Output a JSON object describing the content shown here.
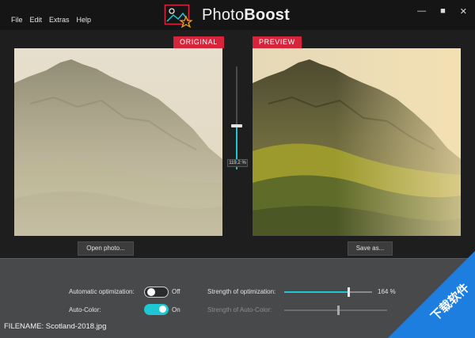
{
  "menu": [
    "File",
    "Edit",
    "Extras",
    "Help"
  ],
  "app": {
    "title_a": "Photo",
    "title_b": "Boost"
  },
  "window": {
    "minimize": "—",
    "maximize": "■",
    "close": "✕"
  },
  "panels": {
    "original_label": "ORIGINAL",
    "preview_label": "PREVIEW"
  },
  "zoom": {
    "label": "119.2 %",
    "level_fraction": 0.42
  },
  "buttons": {
    "open": "Open photo...",
    "save": "Save as..."
  },
  "settings": {
    "auto_opt_label": "Automatic optimization:",
    "auto_opt_state": "Off",
    "auto_color_label": "Auto-Color:",
    "auto_color_state": "On",
    "strength_opt_label": "Strength of optimization:",
    "strength_opt_value": "164 %",
    "strength_opt_fraction": 0.73,
    "strength_color_label": "Strength of Auto-Color:",
    "strength_color_fraction": 0.52
  },
  "file": {
    "label": "FILENAME: Scotland-2018.jpg"
  },
  "watermark": {
    "text": "下载软件"
  },
  "colors": {
    "accent": "#1fc6d4",
    "label_red": "#d6243a",
    "watermark_blue": "#1d7ee0"
  },
  "icons": [
    "photoboost-logo-icon",
    "minimize-icon",
    "maximize-icon",
    "close-icon"
  ]
}
